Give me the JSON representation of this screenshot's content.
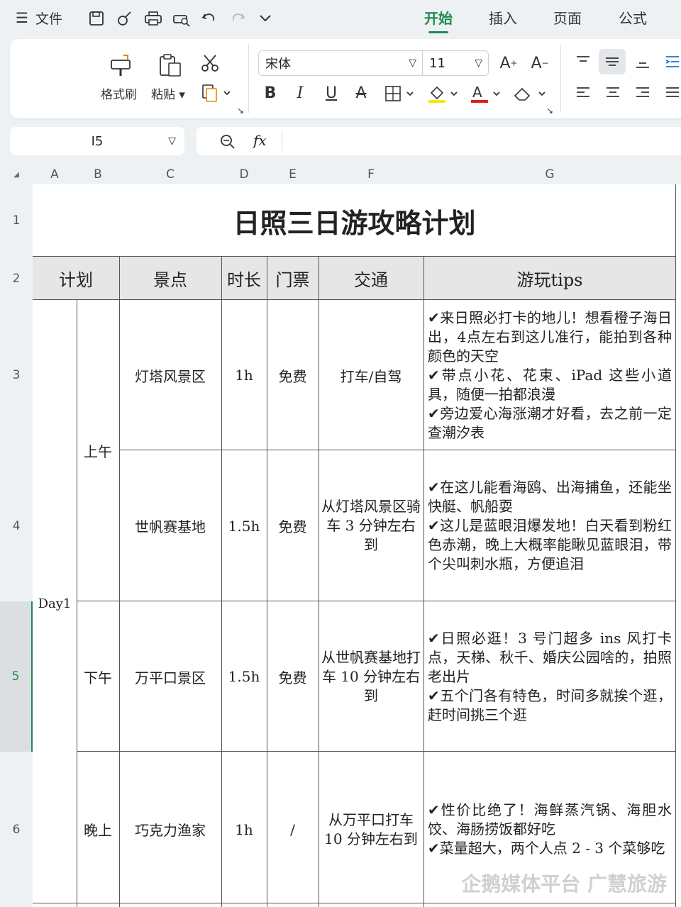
{
  "menubar": {
    "menu_icon": "hamburger-icon",
    "file_label": "文件",
    "tabs": [
      "开始",
      "插入",
      "页面",
      "公式"
    ],
    "active_tab": "开始"
  },
  "ribbon": {
    "format_painter": "格式刷",
    "paste": "粘贴",
    "font_name": "宋体",
    "font_size": "11"
  },
  "formula_bar": {
    "cell_ref": "I5",
    "fx_label": "fx",
    "content": ""
  },
  "columns": [
    "A",
    "B",
    "C",
    "D",
    "E",
    "F",
    "G"
  ],
  "rows": [
    "1",
    "2",
    "3",
    "4",
    "5",
    "6"
  ],
  "selected_row": "5",
  "sheet": {
    "title": "日照三日游攻略计划",
    "headers": {
      "plan": "计划",
      "spot": "景点",
      "duration": "时长",
      "ticket": "门票",
      "transport": "交通",
      "tips": "游玩tips"
    },
    "day": "Day1",
    "periods": {
      "morning": "上午",
      "afternoon": "下午",
      "evening": "晚上"
    },
    "items": [
      {
        "spot": "灯塔风景区",
        "duration": "1h",
        "ticket": "免费",
        "transport": "打车/自驾",
        "tips": "✔来日照必打卡的地儿！想看橙子海日出，4点左右到这儿准行，能拍到各种颜色的天空\n✔带点小花、花束、iPad 这些小道具，随便一拍都浪漫\n✔旁边爱心海涨潮才好看，去之前一定查潮汐表"
      },
      {
        "spot": "世帆赛基地",
        "duration": "1.5h",
        "ticket": "免费",
        "transport": "从灯塔风景区骑车 3 分钟左右到",
        "tips": "✔在这儿能看海鸥、出海捕鱼，还能坐快艇、帆船耍\n✔这儿是蓝眼泪爆发地！白天看到粉红色赤潮，晚上大概率能瞅见蓝眼泪，带个尖叫刺水瓶，方便追泪"
      },
      {
        "spot": "万平口景区",
        "duration": "1.5h",
        "ticket": "免费",
        "transport": "从世帆赛基地打车 10 分钟左右到",
        "tips": "✔日照必逛！3 号门超多 ins 风打卡点，天梯、秋千、婚庆公园啥的，拍照老出片\n✔五个门各有特色，时间多就挨个逛，赶时间挑三个逛"
      },
      {
        "spot": "巧克力渔家",
        "duration": "1h",
        "ticket": "/",
        "transport": "从万平口打车 10 分钟左右到",
        "tips": "✔性价比绝了！海鲜蒸汽锅、海胆水饺、海肠捞饭都好吃\n✔菜量超大，两个人点 2 - 3 个菜够吃"
      }
    ]
  },
  "watermark": "企鹅媒体平台 广慧旅游"
}
